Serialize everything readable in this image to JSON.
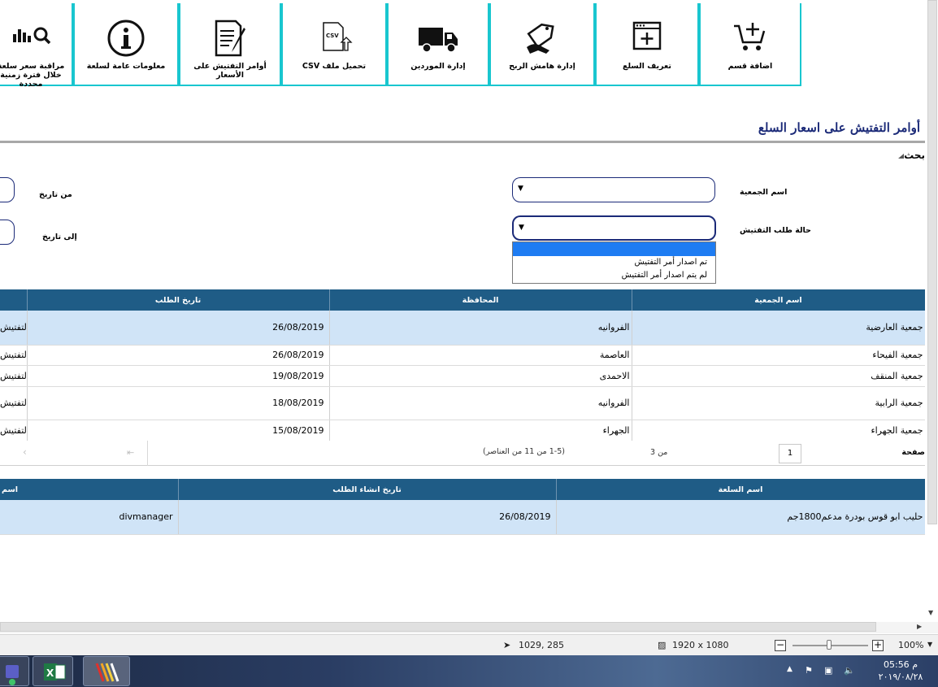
{
  "toolbar": {
    "tiles": [
      {
        "label": "مراقبة سعر سلعة خلال فترة زمنية محددة",
        "icon": "chart-search-icon"
      },
      {
        "label": "معلومات عامة لسلعة",
        "icon": "info-icon"
      },
      {
        "label": "أوامر التفتيش على الأسعار",
        "icon": "document-pen-icon"
      },
      {
        "label": "تحميل ملف CSV",
        "icon": "csv-upload-icon"
      },
      {
        "label": "إدارة الموردين",
        "icon": "truck-icon"
      },
      {
        "label": "إدارة هامش الربح",
        "icon": "price-tag-hand-icon"
      },
      {
        "label": "تعريف السلع",
        "icon": "window-add-icon"
      },
      {
        "label": "اضافة قسم",
        "icon": "cart-add-icon"
      }
    ]
  },
  "page": {
    "title": "أوامر التفتيش على اسعار السلع",
    "search_heading": "بحث"
  },
  "filters": {
    "society_label": "اسم الجمعية",
    "status_label": "حالة طلب التفتيش",
    "from_date_label": "من تاريخ",
    "to_date_label": "إلى تاريخ",
    "status_options": [
      "",
      "تم اصدار أمر التفتيش",
      "لم يتم اصدار أمر التفتيش"
    ]
  },
  "orders_table": {
    "headers": [
      "اسم الجمعية",
      "المحافظة",
      "تاريخ الطلب"
    ],
    "rows": [
      {
        "society": "جمعية العارضية",
        "governorate": "الفروانيه",
        "date": "26/08/2019",
        "status": "لم يتم اصدار أمر التفتيش"
      },
      {
        "society": "جمعية الفيحاء",
        "governorate": "العاصمة",
        "date": "26/08/2019",
        "status": "تم اصدار أمر التفتيش"
      },
      {
        "society": "جمعية المنقف",
        "governorate": "الاحمدى",
        "date": "19/08/2019",
        "status": "تم اصدار أمر التفتيش"
      },
      {
        "society": "جمعية الرابية",
        "governorate": "الفروانيه",
        "date": "18/08/2019",
        "status": "لم يتم اصدار أمر التفتيش"
      },
      {
        "society": "جمعية الجهراء",
        "governorate": "الجهراء",
        "date": "15/08/2019",
        "status": "تم اصدار أمر التفتيش"
      }
    ]
  },
  "pager": {
    "page_word": "صفحة",
    "current_page": "1",
    "of_pages": "من 3",
    "range_text": "(1-5 من 11 من العناصر)"
  },
  "items_table": {
    "headers": [
      "اسم السلعة",
      "تاريخ انشاء الطلب",
      "اسم"
    ],
    "rows": [
      {
        "item": "حليب ابو قوس بودرة مدعم1800جم",
        "created": "26/08/2019",
        "user": "divmanager"
      }
    ]
  },
  "statusbar": {
    "cursor_pos": "1029, 285",
    "image_size": "1920 x 1080",
    "zoom": "100%"
  },
  "taskbar": {
    "time": "05:56 م",
    "date": "٢٠١٩/٠٨/٢٨"
  },
  "colors": {
    "tile_border": "#19c6cf",
    "table_header": "#1f5c86",
    "selected_row": "#d0e4f7",
    "title": "#1b2a78",
    "dropdown_highlight": "#1e7cf2"
  }
}
